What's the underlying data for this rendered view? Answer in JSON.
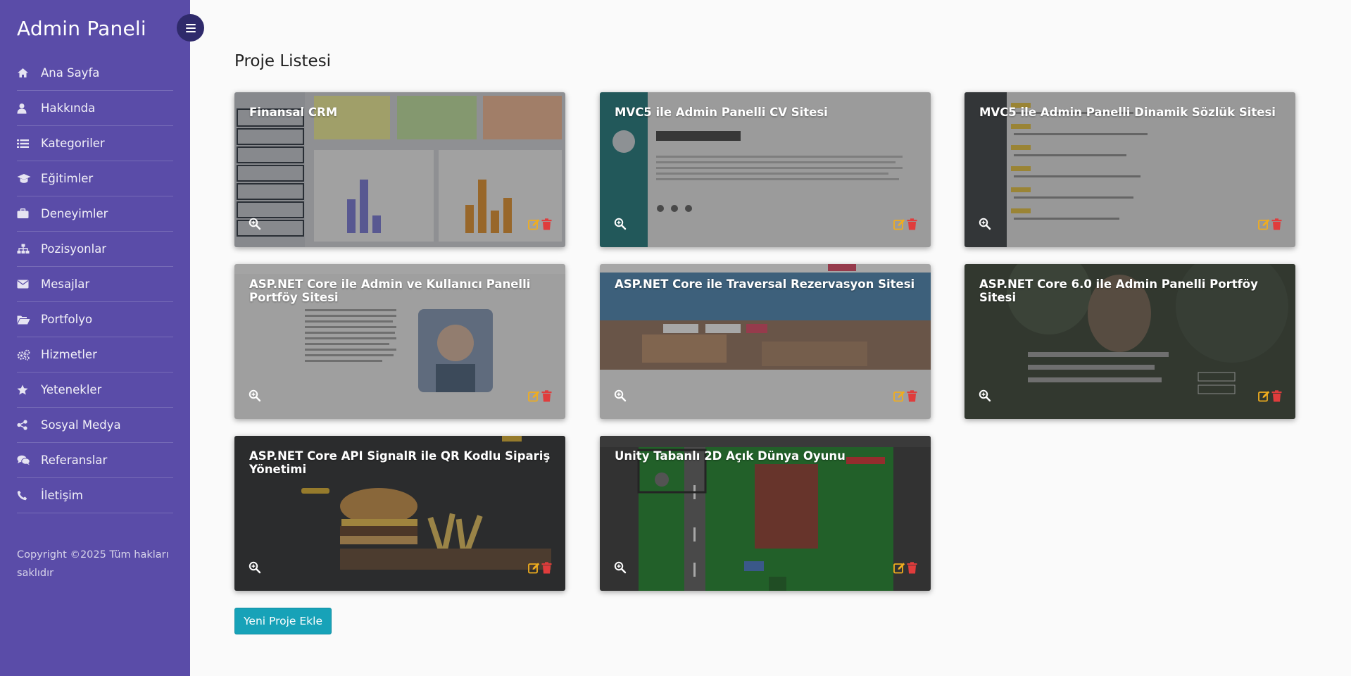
{
  "sidebar": {
    "brand": "Admin Paneli",
    "items": [
      {
        "label": "Ana Sayfa",
        "icon": "home-icon"
      },
      {
        "label": "Hakkında",
        "icon": "user-icon"
      },
      {
        "label": "Kategoriler",
        "icon": "list-icon"
      },
      {
        "label": "Eğitimler",
        "icon": "graduation-cap-icon"
      },
      {
        "label": "Deneyimler",
        "icon": "briefcase-icon"
      },
      {
        "label": "Pozisyonlar",
        "icon": "sitemap-icon"
      },
      {
        "label": "Mesajlar",
        "icon": "envelope-icon"
      },
      {
        "label": "Portfolyo",
        "icon": "folder-open-icon"
      },
      {
        "label": "Hizmetler",
        "icon": "cogs-icon"
      },
      {
        "label": "Yetenekler",
        "icon": "star-icon"
      },
      {
        "label": "Sosyal Medya",
        "icon": "share-icon"
      },
      {
        "label": "Referanslar",
        "icon": "comments-icon"
      },
      {
        "label": "İletişim",
        "icon": "phone-icon"
      }
    ],
    "copyright": "Copyright ©2025 Tüm hakları saklıdır"
  },
  "main": {
    "title": "Proje Listesi",
    "projects": [
      {
        "title": "Finansal CRM",
        "theme": "crm"
      },
      {
        "title": "MVC5 ile Admin Panelli CV Sitesi",
        "theme": "cv"
      },
      {
        "title": "MVC5 ile Admin Panelli Dinamik Sözlük Sitesi",
        "theme": "sozluk"
      },
      {
        "title": "ASP.NET Core ile Admin ve Kullanıcı Panelli Portföy Sitesi",
        "theme": "portfoy"
      },
      {
        "title": "ASP.NET Core ile Traversal Rezervasyon Sitesi",
        "theme": "traversal"
      },
      {
        "title": "ASP.NET Core 6.0 ile Admin Panelli Portföy Sitesi",
        "theme": "dark-portfoy"
      },
      {
        "title": "ASP.NET Core API SignalR ile QR Kodlu Sipariş Yönetimi",
        "theme": "burger"
      },
      {
        "title": "Unity Tabanlı 2D Açık Dünya Oyunu",
        "theme": "unity"
      }
    ],
    "add_button": "Yeni Proje Ekle"
  },
  "colors": {
    "sidebar": "#5a4ca8",
    "toggle": "#2f2a6b",
    "accent": "#17a2b8",
    "edit": "#f0ad1e",
    "delete": "#e03c3c"
  }
}
